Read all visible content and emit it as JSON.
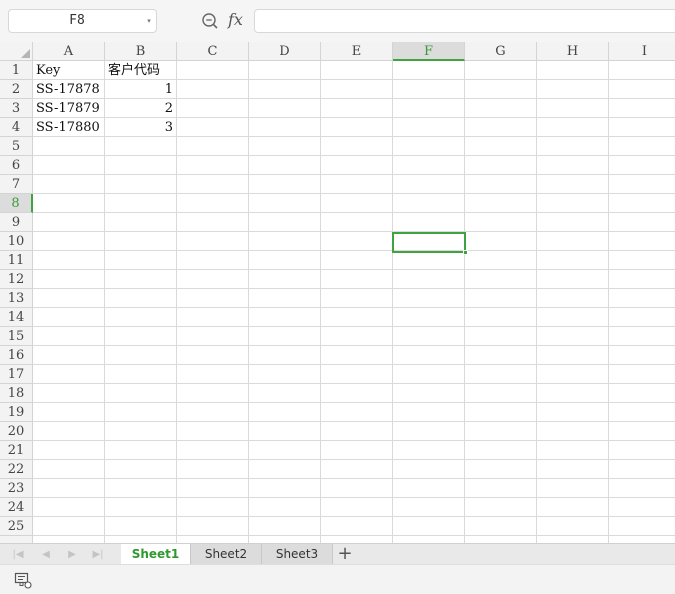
{
  "formula_bar": {
    "name_box": "F8",
    "fx_label": "fx",
    "formula": ""
  },
  "grid": {
    "columns": [
      "A",
      "B",
      "C",
      "D",
      "E",
      "F",
      "G",
      "H",
      "I"
    ],
    "rows": [
      "1",
      "2",
      "3",
      "4",
      "5",
      "6",
      "7",
      "8",
      "9",
      "10",
      "11",
      "12",
      "13",
      "14",
      "15",
      "16",
      "17",
      "18",
      "19",
      "20",
      "21",
      "22",
      "23",
      "24",
      "25"
    ],
    "active_column": "F",
    "active_row": "8",
    "cells": {
      "A1": "Key",
      "B1": "客户代码",
      "A2": "SS-17878",
      "B2": "1",
      "A3": "SS-17879",
      "B3": "2",
      "A4": "SS-17880",
      "B4": "3"
    }
  },
  "sheet_tabs": {
    "tabs": [
      "Sheet1",
      "Sheet2",
      "Sheet3"
    ],
    "active": "Sheet1",
    "add_label": "+"
  },
  "colors": {
    "accent": "#3fa33f",
    "header_bg": "#f3f3f3",
    "grid_line": "#dadada"
  }
}
